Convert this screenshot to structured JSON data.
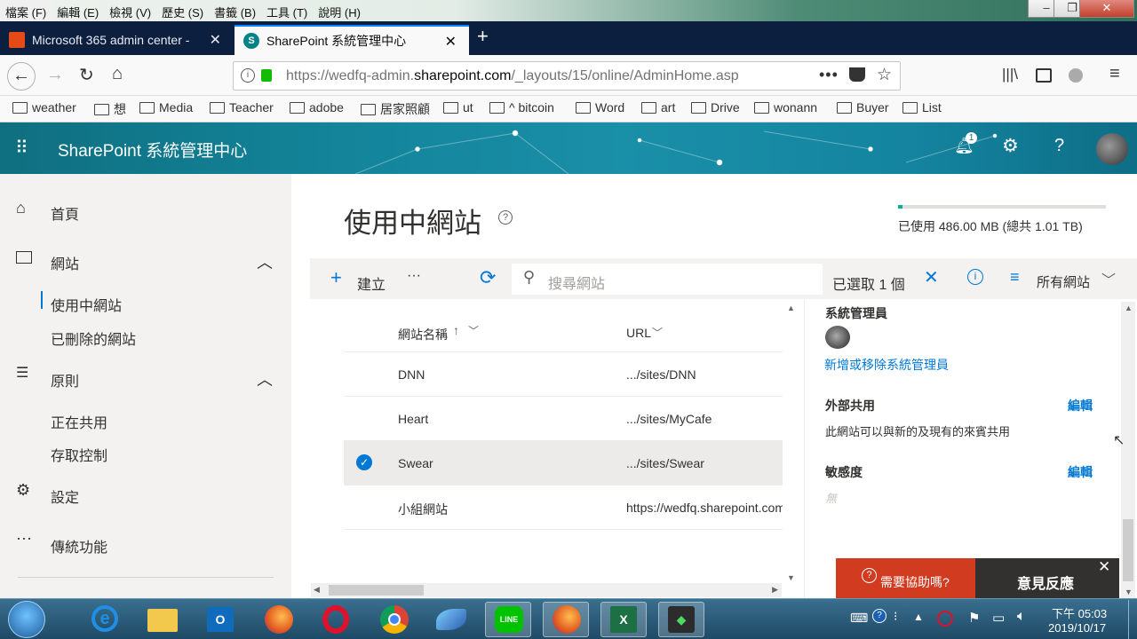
{
  "browser": {
    "menus": [
      "檔案 (F)",
      "編輯 (E)",
      "檢視 (V)",
      "歷史 (S)",
      "書籤 (B)",
      "工具 (T)",
      "說明 (H)"
    ],
    "tabs": [
      {
        "title": "Microsoft 365 admin center -"
      },
      {
        "title": "SharePoint 系統管理中心"
      }
    ],
    "url_prefix": "https://wedfq-admin.",
    "url_domain": "sharepoint.com",
    "url_path": "/_layouts/15/online/AdminHome.asp",
    "bookmarks": [
      "weather",
      "想",
      "Media",
      "Teacher",
      "adobe",
      "居家照顧",
      "ut",
      "^ bitcoin",
      "Word",
      "art",
      "Drive",
      "wonann",
      "Buyer",
      "List"
    ]
  },
  "suite": {
    "title": "SharePoint 系統管理中心",
    "notification_count": "1"
  },
  "sidebar": {
    "home": "首頁",
    "sites": "網站",
    "active_sites": "使用中網站",
    "deleted_sites": "已刪除的網站",
    "policies": "原則",
    "sharing": "正在共用",
    "access_control": "存取控制",
    "settings": "設定",
    "classic": "傳統功能"
  },
  "main": {
    "title": "使用中網站",
    "storage_text": "已使用 486.00 MB (總共 1.01 TB)",
    "storage_fraction": 0.02,
    "create_label": "建立",
    "search_placeholder": "搜尋網站",
    "selected_text": "已選取 1 個",
    "view_label": "所有網站",
    "columns": [
      "網站名稱",
      "URL"
    ],
    "rows": [
      {
        "name": "DNN",
        "url": ".../sites/DNN",
        "selected": false
      },
      {
        "name": "Heart",
        "url": ".../sites/MyCafe",
        "selected": false
      },
      {
        "name": "Swear",
        "url": ".../sites/Swear",
        "selected": true
      },
      {
        "name": "小組網站",
        "url": "https://wedfq.sharepoint.com",
        "selected": false
      }
    ]
  },
  "panel": {
    "admins_title": "系統管理員",
    "admins_link": "新增或移除系統管理員",
    "external_title": "外部共用",
    "external_edit": "編輯",
    "external_desc": "此網站可以與新的及現有的來賓共用",
    "sensitivity_title": "敏感度",
    "sensitivity_edit": "編輯",
    "sensitivity_value": "無"
  },
  "help": {
    "need_help": "需要協助嗎?",
    "feedback": "意見反應"
  },
  "taskbar": {
    "time": "下午 05:03",
    "date": "2019/10/17"
  },
  "colors": {
    "suite": "#1a8fa8",
    "accent": "#0078d4",
    "help_red": "#d13b1f",
    "tabstrip": "#0c1f3f"
  }
}
